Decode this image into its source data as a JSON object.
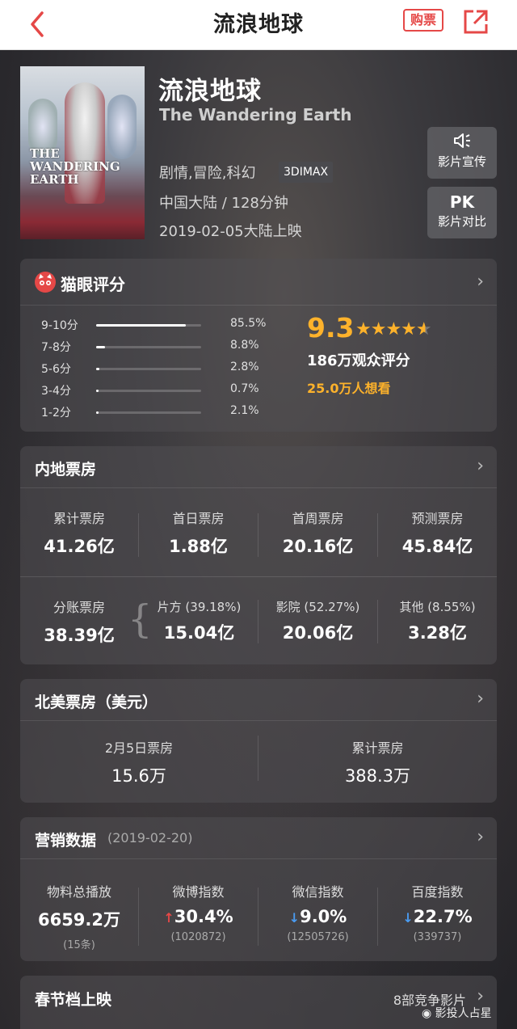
{
  "nav": {
    "title": "流浪地球",
    "buy_label": "购票"
  },
  "movie": {
    "title_cn": "流浪地球",
    "title_en": "The Wandering Earth",
    "genres": "剧情,冒险,科幻",
    "format_badge": "3DIMAX",
    "country_duration": "中国大陆 / 128分钟",
    "release": "2019-02-05大陆上映",
    "poster_text": "THE WANDERING EARTH"
  },
  "side_buttons": {
    "promo": {
      "top": "◁⋮",
      "label": "影片宣传"
    },
    "pk": {
      "top": "PK",
      "label": "影片对比"
    }
  },
  "rating": {
    "title": "猫眼评分",
    "rows": [
      {
        "label": "9-10分",
        "percent": "85.5%",
        "fraction": 0.855
      },
      {
        "label": "7-8分",
        "percent": "8.8%",
        "fraction": 0.088
      },
      {
        "label": "5-6分",
        "percent": "2.8%",
        "fraction": 0.028
      },
      {
        "label": "3-4分",
        "percent": "0.7%",
        "fraction": 0.007
      },
      {
        "label": "1-2分",
        "percent": "2.1%",
        "fraction": 0.021
      }
    ],
    "score": "9.3",
    "stars_display": "★★★★★",
    "stars_value": 4.65,
    "count": "186万观众评分",
    "want_see": "25.0万人想看"
  },
  "mainland": {
    "title": "内地票房",
    "top": [
      {
        "label": "累计票房",
        "value": "41.26亿"
      },
      {
        "label": "首日票房",
        "value": "1.88亿"
      },
      {
        "label": "首周票房",
        "value": "20.16亿"
      },
      {
        "label": "预测票房",
        "value": "45.84亿"
      }
    ],
    "bottom": [
      {
        "label": "分账票房",
        "value": "38.39亿"
      },
      {
        "label": "片方 (39.18%)",
        "value": "15.04亿"
      },
      {
        "label": "影院 (52.27%)",
        "value": "20.06亿"
      },
      {
        "label": "其他 (8.55%)",
        "value": "3.28亿"
      }
    ]
  },
  "north_america": {
    "title": "北美票房（美元）",
    "stats": [
      {
        "label": "2月5日票房",
        "value": "15.6万"
      },
      {
        "label": "累计票房",
        "value": "388.3万"
      }
    ]
  },
  "marketing": {
    "title": "营销数据",
    "date": "(2019-02-20)",
    "stats": [
      {
        "label": "物料总播放",
        "value": "6659.2万",
        "sub": "(15条)",
        "arrow": ""
      },
      {
        "label": "微博指数",
        "value": "30.4%",
        "sub": "(1020872)",
        "arrow": "↑"
      },
      {
        "label": "微信指数",
        "value": "9.0%",
        "sub": "(12505726)",
        "arrow": "↓"
      },
      {
        "label": "百度指数",
        "value": "22.7%",
        "sub": "(339737)",
        "arrow": "↓"
      }
    ]
  },
  "spring": {
    "title": "春节档上映",
    "competitors": "8部竞争影片"
  },
  "watermark": "影投人占星",
  "colors": {
    "accent_red": "#e54847",
    "gold": "#fdb22b",
    "down_blue": "#4a9bf0"
  }
}
